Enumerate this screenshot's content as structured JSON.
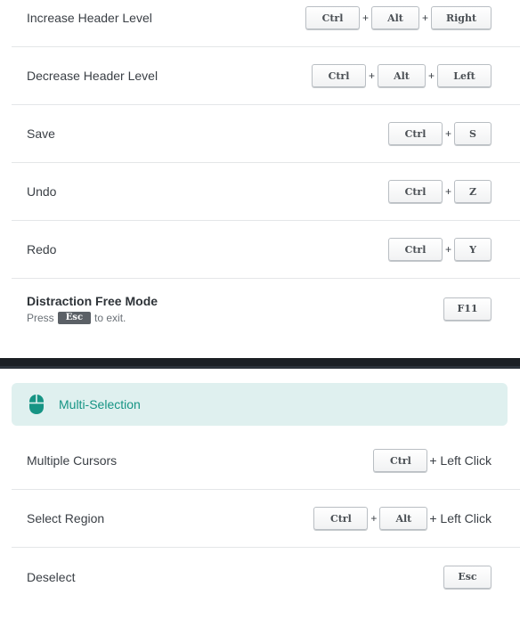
{
  "shortcuts_top": [
    {
      "label": "Increase Header Level",
      "keys": [
        "Ctrl",
        "Alt",
        "Right"
      ]
    },
    {
      "label": "Decrease Header Level",
      "keys": [
        "Ctrl",
        "Alt",
        "Left"
      ]
    },
    {
      "label": "Save",
      "keys": [
        "Ctrl",
        "S"
      ]
    },
    {
      "label": "Undo",
      "keys": [
        "Ctrl",
        "Z"
      ]
    },
    {
      "label": "Redo",
      "keys": [
        "Ctrl",
        "Y"
      ]
    }
  ],
  "distraction_free": {
    "title": "Distraction Free Mode",
    "hint_prefix": "Press",
    "hint_key": "Esc",
    "hint_suffix": "to exit.",
    "key": "F11"
  },
  "plus_sign": "+",
  "multi_selection": {
    "header": "Multi-Selection",
    "icon": "mouse-icon",
    "accent_color": "#169484",
    "header_bg": "#dff0ef",
    "rows": [
      {
        "label": "Multiple Cursors",
        "keys": [
          "Ctrl"
        ],
        "suffix": "+ Left Click"
      },
      {
        "label": "Select Region",
        "keys": [
          "Ctrl",
          "Alt"
        ],
        "suffix": "+ Left Click"
      },
      {
        "label": "Deselect",
        "keys": [
          "Esc"
        ],
        "suffix": ""
      }
    ]
  }
}
